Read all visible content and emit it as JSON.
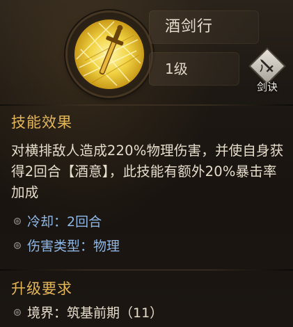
{
  "skill": {
    "name": "酒剑行",
    "level": "1级",
    "type_label": "剑诀",
    "icon": "golden-sword-icon",
    "type_icon": "sword-diamond-icon"
  },
  "effect": {
    "title": "技能效果",
    "description": "对横排敌人造成220%物理伤害，并使自身获得2回合【酒意】，此技能有额外20%暴击率加成"
  },
  "stats": {
    "cooldown": "冷却：2回合",
    "damage_type": "伤害类型：物理"
  },
  "upgrade": {
    "title": "升级要求",
    "realm": "境界：筑基前期（11）"
  },
  "colors": {
    "section_title": "#e4b65a",
    "stat_text": "#8fb8e6",
    "body_text": "#e6ddcd",
    "background": "#1d1813"
  }
}
